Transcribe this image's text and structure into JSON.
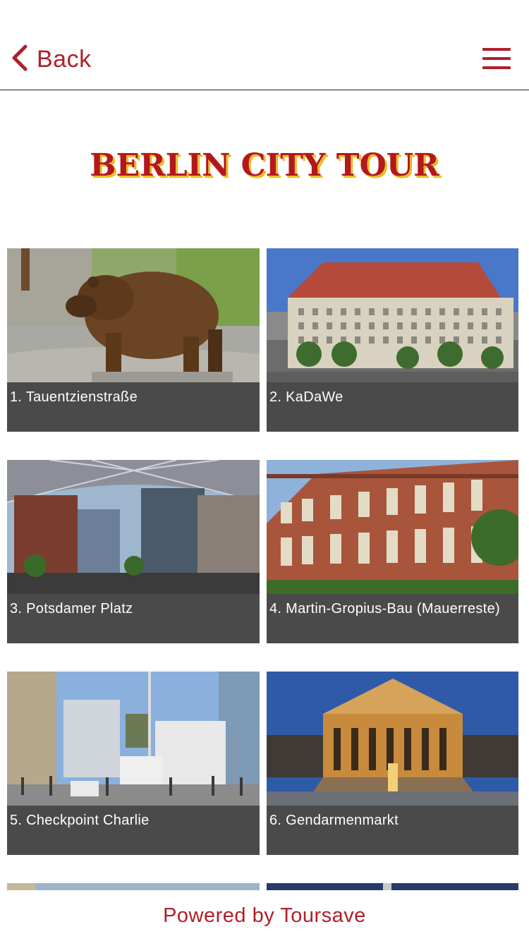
{
  "header": {
    "back_label": "Back",
    "menu_icon": "hamburger-menu-icon",
    "accent_color": "#b0202a"
  },
  "title": "BERLIN CITY TOUR",
  "tours": [
    {
      "label": "1. Tauentzienstraße",
      "image": "brown-bear-photo"
    },
    {
      "label": "2. KaDaWe",
      "image": "department-store-building-photo"
    },
    {
      "label": "3. Potsdamer Platz",
      "image": "sony-center-roof-photo"
    },
    {
      "label": "4. Martin-Gropius-Bau (Mauerreste)",
      "image": "historic-museum-building-photo"
    },
    {
      "label": "5. Checkpoint Charlie",
      "image": "checkpoint-booth-street-photo"
    },
    {
      "label": "6. Gendarmenmarkt",
      "image": "concert-hall-night-photo"
    }
  ],
  "footer": {
    "text": "Powered by Toursave"
  }
}
